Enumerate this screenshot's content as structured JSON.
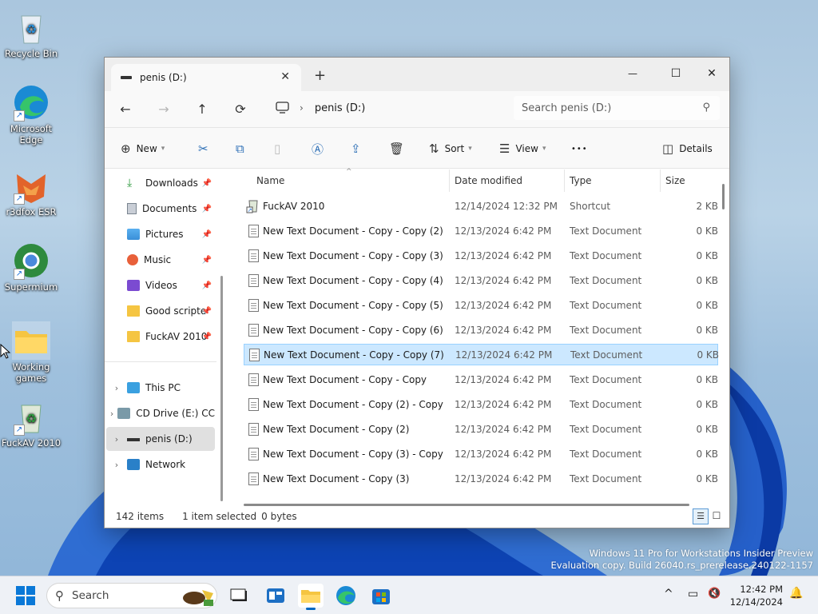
{
  "desktop": {
    "icons": [
      {
        "label": "Recycle Bin"
      },
      {
        "label": "Microsoft Edge"
      },
      {
        "label": "r3dfox ESR"
      },
      {
        "label": "Supermium"
      },
      {
        "label": "Working games"
      },
      {
        "label": "FuckAV 2010"
      }
    ],
    "watermark": {
      "line1": "Windows 11 Pro for Workstations Insider Preview",
      "line2": "Evaluation copy. Build 26040.rs_prerelease.240122-1157"
    }
  },
  "window": {
    "tab_title": "penis (D:)",
    "tab_close": "✕",
    "new_tab": "+",
    "controls": {
      "minimize": "—",
      "maximize": "☐",
      "close": "✕"
    },
    "address": {
      "location": "penis (D:)",
      "separator": "›"
    },
    "search": {
      "placeholder": "Search penis (D:)"
    },
    "toolbar": {
      "new_label": "New",
      "sort_label": "Sort",
      "view_label": "View",
      "more_label": "•••",
      "details_label": "Details"
    },
    "nav": {
      "quick": [
        {
          "label": "Downloads",
          "icon": "download-icon"
        },
        {
          "label": "Documents",
          "icon": "documents-icon"
        },
        {
          "label": "Pictures",
          "icon": "pictures-icon"
        },
        {
          "label": "Music",
          "icon": "music-icon"
        },
        {
          "label": "Videos",
          "icon": "videos-icon"
        },
        {
          "label": "Good scripte",
          "icon": "folder-icon"
        },
        {
          "label": "FuckAV 2010",
          "icon": "folder-icon"
        }
      ],
      "tree": [
        {
          "label": "This PC"
        },
        {
          "label": "CD Drive (E:) CC"
        },
        {
          "label": "penis (D:)"
        },
        {
          "label": "Network"
        }
      ]
    },
    "columns": {
      "name": "Name",
      "date": "Date modified",
      "type": "Type",
      "size": "Size"
    },
    "files": [
      {
        "name": "FuckAV 2010",
        "date": "12/14/2024 12:32 PM",
        "type": "Shortcut",
        "size": "2 KB"
      },
      {
        "name": "New Text Document - Copy - Copy (2)",
        "date": "12/13/2024 6:42 PM",
        "type": "Text Document",
        "size": "0 KB"
      },
      {
        "name": "New Text Document - Copy - Copy (3)",
        "date": "12/13/2024 6:42 PM",
        "type": "Text Document",
        "size": "0 KB"
      },
      {
        "name": "New Text Document - Copy - Copy (4)",
        "date": "12/13/2024 6:42 PM",
        "type": "Text Document",
        "size": "0 KB"
      },
      {
        "name": "New Text Document - Copy - Copy (5)",
        "date": "12/13/2024 6:42 PM",
        "type": "Text Document",
        "size": "0 KB"
      },
      {
        "name": "New Text Document - Copy - Copy (6)",
        "date": "12/13/2024 6:42 PM",
        "type": "Text Document",
        "size": "0 KB"
      },
      {
        "name": "New Text Document - Copy - Copy (7)",
        "date": "12/13/2024 6:42 PM",
        "type": "Text Document",
        "size": "0 KB"
      },
      {
        "name": "New Text Document - Copy - Copy",
        "date": "12/13/2024 6:42 PM",
        "type": "Text Document",
        "size": "0 KB"
      },
      {
        "name": "New Text Document - Copy (2) - Copy",
        "date": "12/13/2024 6:42 PM",
        "type": "Text Document",
        "size": "0 KB"
      },
      {
        "name": "New Text Document - Copy (2)",
        "date": "12/13/2024 6:42 PM",
        "type": "Text Document",
        "size": "0 KB"
      },
      {
        "name": "New Text Document - Copy (3) - Copy",
        "date": "12/13/2024 6:42 PM",
        "type": "Text Document",
        "size": "0 KB"
      },
      {
        "name": "New Text Document - Copy (3)",
        "date": "12/13/2024 6:42 PM",
        "type": "Text Document",
        "size": "0 KB"
      }
    ],
    "status": {
      "count": "142 items",
      "selection": "1 item selected",
      "size": "0 bytes"
    }
  },
  "taskbar": {
    "search_placeholder": "Search",
    "clock": {
      "time": "12:42 PM",
      "date": "12/14/2024"
    },
    "tray_chevron": "^"
  },
  "colors": {
    "accent": "#0067c0",
    "selection": "#cce8ff"
  }
}
